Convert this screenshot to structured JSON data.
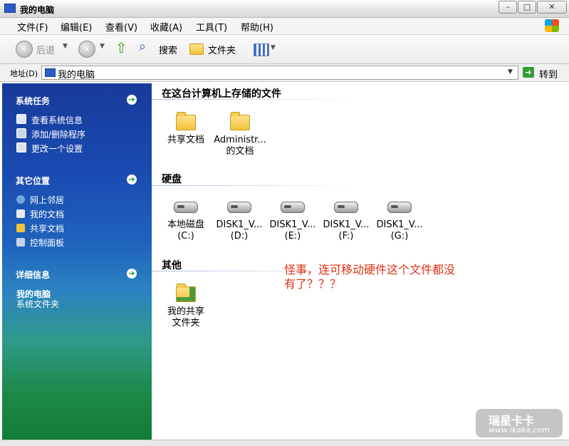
{
  "window": {
    "title": "我的电脑",
    "buttons": {
      "minimize": "–",
      "maximize": "□",
      "close": "✕"
    }
  },
  "menu": [
    "文件(F)",
    "编辑(E)",
    "查看(V)",
    "收藏(A)",
    "工具(T)",
    "帮助(H)"
  ],
  "toolbar": {
    "back_label": "后退",
    "search_label": "搜索",
    "folders_label": "文件夹"
  },
  "address": {
    "label": "地址(D)",
    "value": "我的电脑",
    "go_label": "转到"
  },
  "left_pane": {
    "system_tasks": {
      "title": "系统任务",
      "items": [
        "查看系统信息",
        "添加/删除程序",
        "更改一个设置"
      ]
    },
    "other_places": {
      "title": "其它位置",
      "items": [
        "网上邻居",
        "我的文档",
        "共享文档",
        "控制面板"
      ]
    },
    "details": {
      "title": "详细信息",
      "name": "我的电脑",
      "type": "系统文件夹"
    }
  },
  "content": {
    "stored_files": {
      "title": "在这台计算机上存储的文件",
      "items": [
        {
          "line1": "共享文档",
          "line2": ""
        },
        {
          "line1": "Administr...",
          "line2": "的文档"
        }
      ]
    },
    "hard_drives": {
      "title": "硬盘",
      "items": [
        {
          "line1": "本地磁盘",
          "line2": "(C:)"
        },
        {
          "line1": "DISK1_V...",
          "line2": "(D:)"
        },
        {
          "line1": "DISK1_V...",
          "line2": "(E:)"
        },
        {
          "line1": "DISK1_V...",
          "line2": "(F:)"
        },
        {
          "line1": "DISK1_V...",
          "line2": "(G:)"
        }
      ]
    },
    "other": {
      "title": "其他",
      "items": [
        {
          "line1": "我的共享",
          "line2": "文件夹"
        }
      ]
    },
    "annotation": "怪事，连可移动硬件这个文件都没有了？？？"
  },
  "watermark": {
    "line1": "瑞星卡卡",
    "line2": "www.ikaka.com"
  },
  "colors": {
    "annotation": "#e03014",
    "task_pane_top": "#173b9b",
    "task_pane_bottom": "#137d33"
  }
}
